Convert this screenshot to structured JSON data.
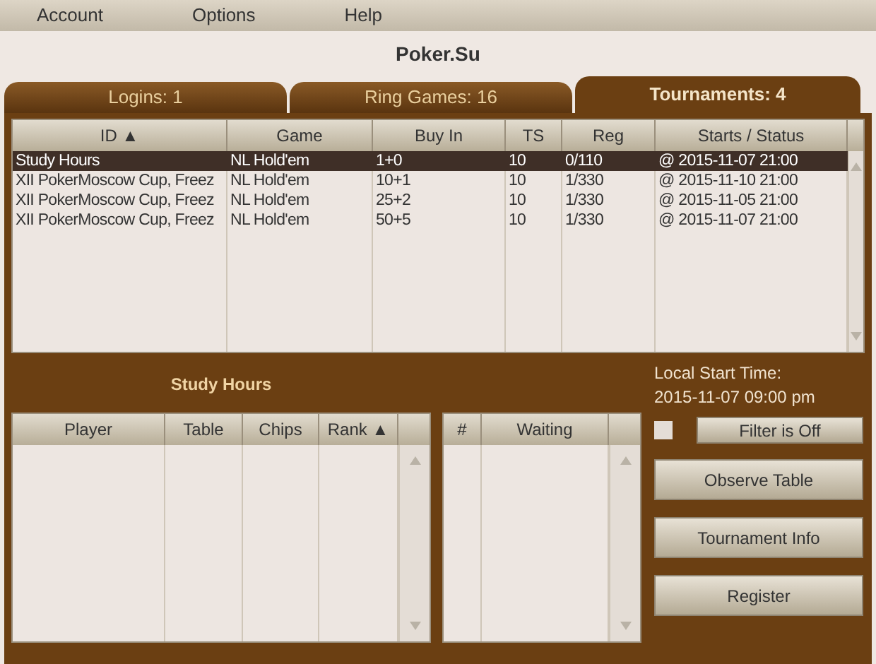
{
  "menu": [
    {
      "label": "Account"
    },
    {
      "label": "Options"
    },
    {
      "label": "Help"
    }
  ],
  "title": "Poker.Su",
  "tabs": [
    {
      "label": "Logins: 1",
      "selected": false
    },
    {
      "label": "Ring Games: 16",
      "selected": false
    },
    {
      "label": "Tournaments: 4",
      "selected": true
    }
  ],
  "tournaments": {
    "columns": [
      "ID ▲",
      "Game",
      "Buy In",
      "TS",
      "Reg",
      "Starts / Status"
    ],
    "rows": [
      {
        "selected": true,
        "cells": [
          "Study Hours",
          "NL Hold'em",
          "1+0",
          "10",
          "0/110",
          "@ 2015-11-07 21:00"
        ]
      },
      {
        "selected": false,
        "cells": [
          "XII PokerMoscow Cup, Freez",
          "NL Hold'em",
          "10+1",
          "10",
          "1/330",
          "@ 2015-11-10 21:00"
        ]
      },
      {
        "selected": false,
        "cells": [
          "XII PokerMoscow Cup, Freez",
          "NL Hold'em",
          "25+2",
          "10",
          "1/330",
          "@ 2015-11-05 21:00"
        ]
      },
      {
        "selected": false,
        "cells": [
          "XII PokerMoscow Cup, Freez",
          "NL Hold'em",
          "50+5",
          "10",
          "1/330",
          "@ 2015-11-07 21:00"
        ]
      }
    ]
  },
  "details_title": "Study Hours",
  "players": {
    "columns": [
      "Player",
      "Table",
      "Chips",
      "Rank ▲"
    ]
  },
  "waiting": {
    "columns": [
      "#",
      "Waiting"
    ]
  },
  "local_start": {
    "label": "Local Start Time:",
    "value": "2015-11-07 09:00 pm"
  },
  "filter": {
    "checked": false,
    "button": "Filter is Off"
  },
  "buttons": [
    "Observe Table",
    "Tournament Info",
    "Register"
  ]
}
